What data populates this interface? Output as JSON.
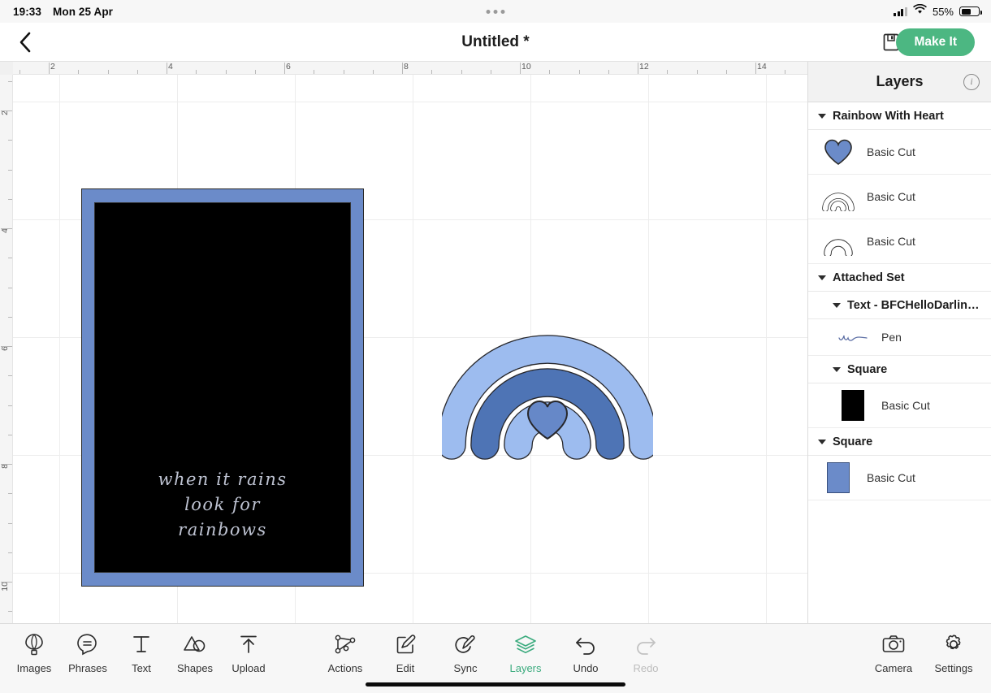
{
  "status_bar": {
    "time": "19:33",
    "date": "Mon 25 Apr",
    "battery_percent": "55%"
  },
  "top_bar": {
    "title": "Untitled *",
    "make_it_label": "Make It",
    "back_icon": "chevron-left-icon",
    "save_icon": "floppy-disk-icon"
  },
  "rulers": {
    "horizontal_labels": [
      "2",
      "4",
      "6",
      "8",
      "10",
      "12",
      "14"
    ],
    "vertical_labels": [
      "2",
      "4",
      "6",
      "8",
      "10"
    ]
  },
  "canvas": {
    "poster": {
      "frame_color": "#6b8bc9",
      "mat_color": "#000000",
      "text_lines": [
        "when it rains",
        "look for",
        "rainbows"
      ],
      "text_color": "#cfd4e4"
    },
    "rainbow": {
      "outer_arc_color": "#9dbcef",
      "middle_arc_color": "#4e74b5",
      "inner_arc_color": "#9dbcef",
      "heart_color": "#6688c8",
      "stroke_color": "#27272b"
    }
  },
  "layers_panel": {
    "title": "Layers",
    "info_icon": "info-icon",
    "groups": [
      {
        "name": "Rainbow With Heart",
        "level": 0,
        "rows": [
          {
            "label": "Basic Cut",
            "thumb": "heart-thumb",
            "level": 0
          },
          {
            "label": "Basic Cut",
            "thumb": "double-arc-thumb",
            "level": 0
          },
          {
            "label": "Basic Cut",
            "thumb": "single-arc-thumb",
            "level": 0
          }
        ]
      },
      {
        "name": "Attached Set",
        "level": 0,
        "rows": []
      },
      {
        "name": "Text - BFCHelloDarling-...",
        "level": 1,
        "rows": [
          {
            "label": "Pen",
            "thumb": "script-squiggle-thumb",
            "level": 1
          }
        ]
      },
      {
        "name": "Square",
        "level": 1,
        "rows": [
          {
            "label": "Basic Cut",
            "thumb": "black-square-thumb",
            "level": 1
          }
        ]
      },
      {
        "name": "Square",
        "level": 0,
        "rows": [
          {
            "label": "Basic Cut",
            "thumb": "blue-square-thumb",
            "level": 0
          }
        ]
      }
    ]
  },
  "bottom_bar": {
    "left_tools": [
      {
        "label": "Images",
        "icon": "hot-air-balloon-icon"
      },
      {
        "label": "Phrases",
        "icon": "speech-bubble-icon"
      },
      {
        "label": "Text",
        "icon": "text-t-icon"
      },
      {
        "label": "Shapes",
        "icon": "shapes-icon"
      },
      {
        "label": "Upload",
        "icon": "upload-arrow-icon"
      }
    ],
    "center_tools": [
      {
        "label": "Actions",
        "icon": "nodes-icon",
        "state": "normal"
      },
      {
        "label": "Edit",
        "icon": "pencil-square-icon",
        "state": "normal"
      },
      {
        "label": "Sync",
        "icon": "sync-pen-icon",
        "state": "normal"
      },
      {
        "label": "Layers",
        "icon": "layers-stack-icon",
        "state": "active"
      },
      {
        "label": "Undo",
        "icon": "undo-arrow-icon",
        "state": "normal"
      },
      {
        "label": "Redo",
        "icon": "redo-arrow-icon",
        "state": "disabled"
      }
    ],
    "right_tools": [
      {
        "label": "Camera",
        "icon": "camera-icon"
      },
      {
        "label": "Settings",
        "icon": "gear-icon"
      }
    ]
  },
  "theme": {
    "accent_green": "#4cb782",
    "blue_light": "#9dbcef",
    "blue_dark": "#4e74b5",
    "blue_mid": "#6b8bc9"
  }
}
